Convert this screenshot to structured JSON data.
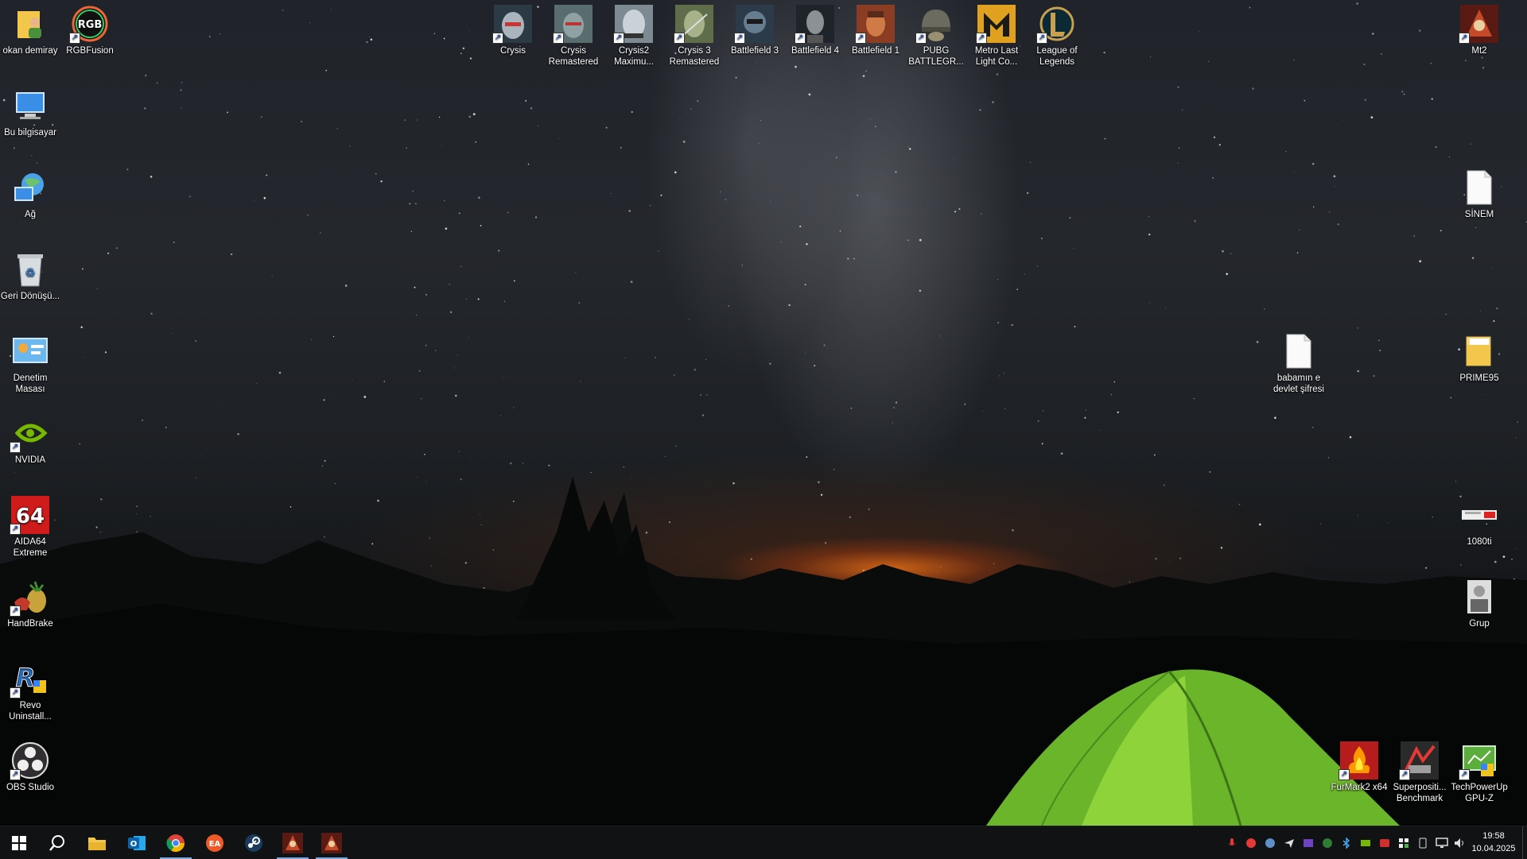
{
  "desktop": {
    "left_icons": [
      {
        "label": "okan demiray",
        "icon": "user-folder-icon"
      },
      {
        "label": "Bu bilgisayar",
        "icon": "computer-icon"
      },
      {
        "label": "Ağ",
        "icon": "network-icon"
      },
      {
        "label": "Geri Dönüşü...",
        "icon": "recycle-bin-icon"
      },
      {
        "label": "Denetim Masası",
        "icon": "control-panel-icon"
      },
      {
        "label": "NVIDIA",
        "icon": "nvidia-icon"
      },
      {
        "label": "AIDA64 Extreme",
        "icon": "aida64-icon"
      },
      {
        "label": "HandBrake",
        "icon": "handbrake-icon"
      },
      {
        "label": "Revo Uninstall...",
        "icon": "revo-uninstaller-icon"
      },
      {
        "label": "OBS Studio",
        "icon": "obs-icon"
      }
    ],
    "rgb_icon": {
      "label": "RGBFusion",
      "icon": "rgbfusion-icon",
      "badge": "RGB"
    },
    "top_icons": [
      {
        "label": "Crysis",
        "icon": "crysis-icon"
      },
      {
        "label": "Crysis Remastered",
        "icon": "crysis-remastered-icon"
      },
      {
        "label": "Crysis2 Maximu...",
        "icon": "crysis2-icon"
      },
      {
        "label": "Crysis 3 Remastered",
        "icon": "crysis3-icon"
      },
      {
        "label": "Battlefield 3",
        "icon": "battlefield3-icon"
      },
      {
        "label": "Battlefield 4",
        "icon": "battlefield4-icon"
      },
      {
        "label": "Battlefield 1",
        "icon": "battlefield1-icon"
      },
      {
        "label": "PUBG BATTLEGR...",
        "icon": "pubg-icon"
      },
      {
        "label": "Metro Last Light Co...",
        "icon": "metro-icon"
      },
      {
        "label": "League of Legends",
        "icon": "league-of-legends-icon"
      }
    ],
    "right_icons": [
      {
        "label": "Mt2",
        "icon": "mt2-icon"
      },
      {
        "label": "SİNEM",
        "icon": "document-icon"
      },
      {
        "label": "babamın e devlet şifresi",
        "icon": "document-icon"
      },
      {
        "label": "PRIME95",
        "icon": "folder-icon"
      },
      {
        "label": "1080ti",
        "icon": "gpu-image-icon"
      },
      {
        "label": "Grup",
        "icon": "group-photo-icon"
      },
      {
        "label": "FurMark2 x64",
        "icon": "furmark-icon"
      },
      {
        "label": "Superpositi... Benchmark",
        "icon": "superposition-icon"
      },
      {
        "label": "TechPowerUp GPU-Z",
        "icon": "gpuz-icon"
      }
    ]
  },
  "taskbar": {
    "pinned": [
      {
        "name": "start-button",
        "icon": "windows-logo-icon"
      },
      {
        "name": "search-button",
        "icon": "search-icon"
      },
      {
        "name": "file-explorer",
        "icon": "folder-icon"
      },
      {
        "name": "outlook",
        "icon": "outlook-icon",
        "glyph": "O"
      },
      {
        "name": "chrome",
        "icon": "chrome-icon"
      },
      {
        "name": "ea-app",
        "icon": "ea-icon",
        "glyph": "EA"
      },
      {
        "name": "steam",
        "icon": "steam-icon"
      },
      {
        "name": "mt2-window-1",
        "icon": "mt2-icon"
      },
      {
        "name": "mt2-window-2",
        "icon": "mt2-icon"
      }
    ],
    "tray_icons": [
      "mic-icon",
      "red-app-icon",
      "steam-tray-icon",
      "plane-icon",
      "gpu-tray-icon",
      "xbox-icon",
      "bluetooth-icon",
      "nvidia-tray-icon",
      "red-tray-icon",
      "defender-icon",
      "phone-link-icon",
      "network-icon",
      "volume-icon"
    ],
    "clock": {
      "time": "19:58",
      "date": "10.04.2025"
    }
  }
}
